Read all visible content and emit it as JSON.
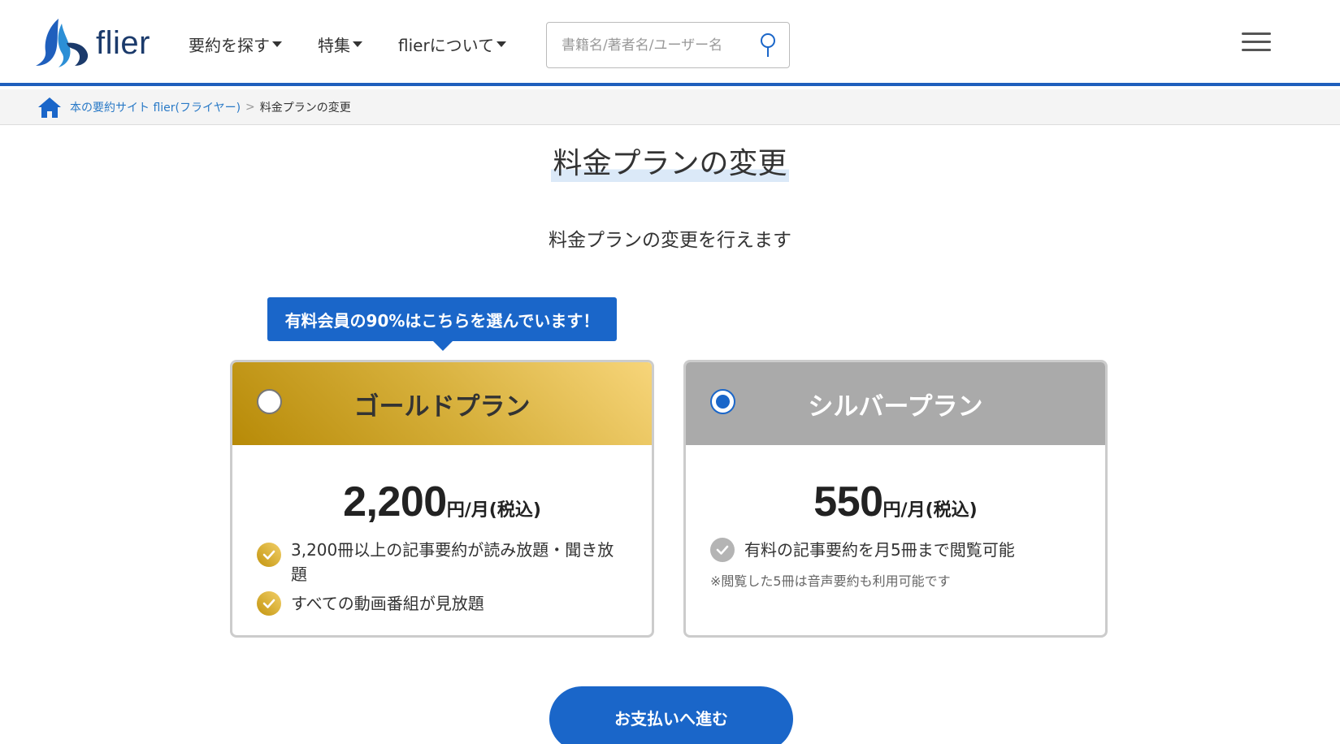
{
  "header": {
    "logo_text": "flier",
    "nav": [
      {
        "label": "要約を探す"
      },
      {
        "label": "特集"
      },
      {
        "label": "flierについて"
      }
    ],
    "search": {
      "placeholder": "書籍名/著者名/ユーザー名"
    }
  },
  "breadcrumb": {
    "home_link": "本の要約サイト flier(フライヤー)",
    "separator": ">",
    "current": "料金プランの変更"
  },
  "page": {
    "title": "料金プランの変更",
    "subtitle": "料金プランの変更を行えます",
    "badge": "有料会員の90%はこちらを選んでいます！"
  },
  "plans": [
    {
      "name": "ゴールドプラン",
      "selected": false,
      "price": "2,200",
      "unit": "円/月(税込)",
      "features": [
        "3,200冊以上の記事要約が読み放題・聞き放題",
        "すべての動画番組が見放題"
      ],
      "color": "#d6af3a"
    },
    {
      "name": "シルバープラン",
      "selected": true,
      "price": "550",
      "unit": "円/月(税込)",
      "features": [
        "有料の記事要約を月5冊まで閲覧可能"
      ],
      "note": "※閲覧した5冊は音声要約も利用可能です",
      "color": "#aaaaaa"
    }
  ],
  "cta": {
    "label": "お支払いへ進む"
  },
  "colors": {
    "accent": "#1a66c9",
    "header_border": "#1f5fbd",
    "link": "#2a7ac7"
  }
}
